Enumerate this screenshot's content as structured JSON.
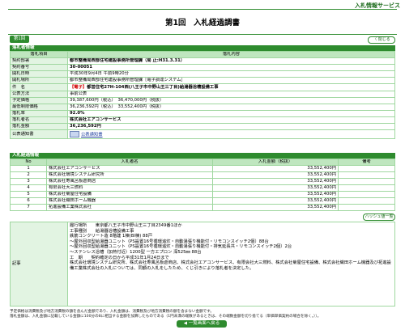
{
  "header": {
    "service_title": "入札情報サービス",
    "page_title": "第1回　入札経過調書"
  },
  "tabs": {
    "first": "第1回"
  },
  "buttons": {
    "close": "〈 閉じる",
    "haschuu": "ハッシュ値一覧",
    "back": "◀ 一覧画面へ戻る"
  },
  "info": {
    "section": "落札者情報",
    "col_item": "落札項目",
    "col_content": "落札内容",
    "rows": {
      "department_label": "契約部署",
      "department_value": "都市整備局西部住宅建設事務所管理課（局 止:H31.3.31）",
      "number_label": "契約番号",
      "number_value": "30-00051",
      "datetime_label": "開札日時",
      "datetime_value": "平成30年9月4日 午前9時20分",
      "place_label": "開札場所",
      "place_value": "都市整備局西部住宅建設事務所管理課［電子調達システム］",
      "subject_label": "件　名",
      "subject_tag": "【電子】",
      "subject_value": "都営住宅27H-104西(八王子市中野山王三丁目)給湯器浴槽設備工事",
      "method_label": "公表方法",
      "method_value": "事前公表",
      "planned_label": "予定価格",
      "planned_value": "39,387,600円（税込）　36,470,000円（税抜）",
      "minimum_label": "最低制限価格",
      "minimum_value": "36,236,592円（税込）　33,552,400円（税抜）",
      "rate_label": "落札率",
      "rate_value": "92.0%",
      "winner_label": "落札者名",
      "winner_value": "株式会社エアコンサービス",
      "amount_label": "落札金額",
      "amount_value": "36,236,592円",
      "notice_label": "公表通知書",
      "notice_value": "公表通知書"
    }
  },
  "bids": {
    "section": "入札経過情報",
    "col_no": "No",
    "col_name": "入札者名",
    "col_amount": "入札金額（税抜）",
    "col_note": "備考",
    "rows": [
      {
        "no": "1",
        "name": "株式会社エアコンサービス",
        "amount": "33,552,400円",
        "note": ""
      },
      {
        "no": "2",
        "name": "株式会社環境システム研究所",
        "amount": "33,552,400円",
        "note": ""
      },
      {
        "no": "3",
        "name": "株式会社寿風呂板倉商店",
        "amount": "33,552,400円",
        "note": ""
      },
      {
        "no": "4",
        "name": "有限会社大三燃料",
        "amount": "33,552,400円",
        "note": ""
      },
      {
        "no": "5",
        "name": "株式会社菊屋住宅設備",
        "amount": "33,552,400円",
        "note": ""
      },
      {
        "no": "6",
        "name": "株式会社織田ホーム機器",
        "amount": "33,552,400円",
        "note": ""
      },
      {
        "no": "7",
        "name": "拓進設備工業株式会社",
        "amount": "33,552,400円",
        "note": ""
      }
    ]
  },
  "remarks": {
    "label": "記事",
    "lines": [
      "履行場所　　東京都八王子市中野山王三丁目2349番1ほか",
      "工事種別　　給湯器浴槽設備工事",
      "鉄筋コンクリート造 8階建 1棟(BI棟) 88戸",
      "～屋外回収型給湯器ユニット（PS設置16号循環追炊・自動湯張り機能付・リモコンスイッチ2個）88台",
      "～屋外回収型給湯器ユニット（PS設置16号循環追炊・自動湯張り機能付・排気延長共・リモコンスイッチ2個）2台",
      "～ステンレス浴槽（加熱付近）1200型 一方エプロン 深525㎜ 88台",
      "工　期　　契約確定の日から平成31年1月24日まで",
      "株式会社環境システム研究所、株式会社寿風呂板倉商店、株式会社エアコンサービス、有限会社大三燃料、株式会社菊屋住宅設備、株式会社織田ホーム機器及び拓進設備工業株式会社の入札については、同額の入札をしたため、くじ引きにより落札者を決定した。"
    ]
  },
  "footer_notes": [
    "予定価格は消費税及び地方消費税の額を含んだ金額であり、入札金額は、消費税及び地方消費税の額を含まない金額です。",
    "落札金額は、入札金額に記載している金額に100分の8に相当する金額を加算したものである（1円未満の端数があるときは、その端数金額を切り捨てる（単価単価契約の場合を除く。））。"
  ],
  "colors": {
    "accent": "#2e8b2e",
    "label_bg": "#e2f4e2",
    "header_bg": "#bfe6bf",
    "warning": "#d00000"
  }
}
